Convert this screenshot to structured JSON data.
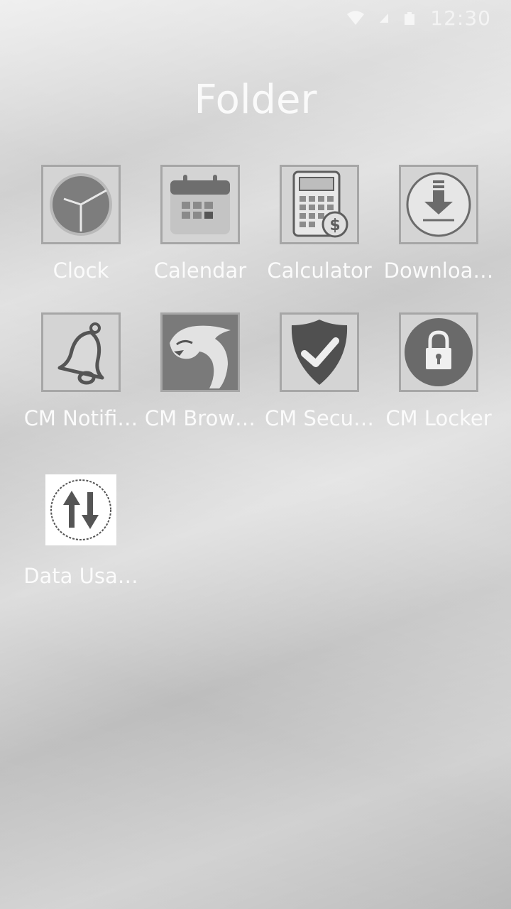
{
  "status_bar": {
    "time": "12:30",
    "icons": [
      "wifi-icon",
      "signal-icon",
      "battery-icon"
    ]
  },
  "folder": {
    "title": "Folder"
  },
  "apps": [
    {
      "label": "Clock",
      "icon": "clock-icon"
    },
    {
      "label": "Calendar",
      "icon": "calendar-icon"
    },
    {
      "label": "Calculator",
      "icon": "calculator-icon"
    },
    {
      "label": "Downloa…",
      "icon": "download-icon"
    },
    {
      "label": "CM Notifi…",
      "icon": "bell-icon"
    },
    {
      "label": "CM Brow…",
      "icon": "cheetah-icon"
    },
    {
      "label": "CM Secu…",
      "icon": "shield-check-icon"
    },
    {
      "label": "CM Locker",
      "icon": "padlock-icon"
    },
    {
      "label": "Data Usa…",
      "icon": "data-arrows-icon"
    }
  ]
}
